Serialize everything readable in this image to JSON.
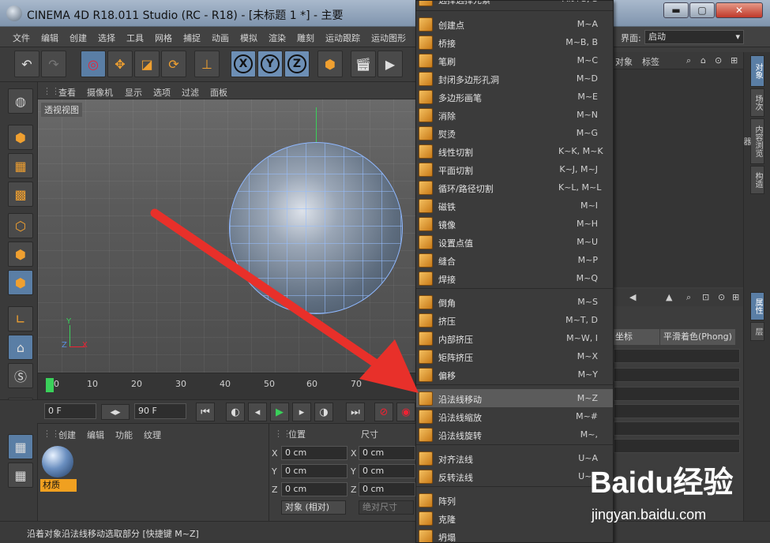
{
  "window": {
    "title": "CINEMA 4D R18.011 Studio (RC - R18) - [未标题 1 *] - 主要",
    "minimize": "▬",
    "maximize": "▢",
    "close": "✕"
  },
  "menubar": {
    "items": [
      "文件",
      "编辑",
      "创建",
      "选择",
      "工具",
      "网格",
      "捕捉",
      "动画",
      "模拟",
      "渲染",
      "雕刻",
      "运动跟踪",
      "运动图形"
    ],
    "interface_label": "界面:",
    "interface_value": "启动"
  },
  "toolbar": {
    "undo": "↶",
    "redo": "↷",
    "axis_x": "X",
    "axis_y": "Y",
    "axis_z": "Z"
  },
  "viewport": {
    "menu": [
      "查看",
      "摄像机",
      "显示",
      "选项",
      "过滤",
      "面板"
    ],
    "label": "透视视图",
    "axis_y": "Y",
    "axis_x": "X",
    "axis_z": "Z"
  },
  "timeline": {
    "ticks": [
      "0",
      "10",
      "20",
      "30",
      "40",
      "50",
      "60",
      "70"
    ]
  },
  "transport": {
    "start_frame": "0 F",
    "end_frame": "90 F"
  },
  "material_panel": {
    "tabs": [
      "创建",
      "编辑",
      "功能",
      "纹理"
    ],
    "material_label": "材质"
  },
  "coord_panel": {
    "position_label": "位置",
    "size_label": "尺寸",
    "x": "X",
    "y": "Y",
    "z": "Z",
    "px": "0 cm",
    "py": "0 cm",
    "pz": "0 cm",
    "sx": "0 cm",
    "sy": "0 cm",
    "sz": "0 cm",
    "object_mode": "对象 (相对)",
    "absolute_size": "绝对尺寸"
  },
  "right_panel": {
    "tabs": [
      "对象",
      "标签"
    ],
    "vtabs": [
      "对象",
      "场次",
      "内容浏览器",
      "构造"
    ],
    "attr_vtabs": [
      "属性",
      "层"
    ],
    "coord_tab": "坐标",
    "phong_tab": "平滑着色(Phong)"
  },
  "context_menu": {
    "top_partial": {
      "label": "选择选择元素",
      "key": "Alt+S, S"
    },
    "items": [
      {
        "label": "创建点",
        "key": "M~A"
      },
      {
        "label": "桥接",
        "key": "M~B, B"
      },
      {
        "label": "笔刷",
        "key": "M~C"
      },
      {
        "label": "封闭多边形孔洞",
        "key": "M~D"
      },
      {
        "label": "多边形画笔",
        "key": "M~E"
      },
      {
        "label": "消除",
        "key": "M~N"
      },
      {
        "label": "熨烫",
        "key": "M~G"
      },
      {
        "label": "线性切割",
        "key": "K~K, M~K"
      },
      {
        "label": "平面切割",
        "key": "K~J, M~J"
      },
      {
        "label": "循环/路径切割",
        "key": "K~L, M~L"
      },
      {
        "label": "磁铁",
        "key": "M~I"
      },
      {
        "label": "镜像",
        "key": "M~H"
      },
      {
        "label": "设置点值",
        "key": "M~U"
      },
      {
        "label": "缝合",
        "key": "M~P"
      },
      {
        "label": "焊接",
        "key": "M~Q"
      },
      {
        "label": "倒角",
        "key": "M~S"
      },
      {
        "label": "挤压",
        "key": "M~T, D"
      },
      {
        "label": "内部挤压",
        "key": "M~W, I"
      },
      {
        "label": "矩阵挤压",
        "key": "M~X"
      },
      {
        "label": "偏移",
        "key": "M~Y"
      },
      {
        "label": "沿法线移动",
        "key": "M~Z"
      },
      {
        "label": "沿法线缩放",
        "key": "M~#"
      },
      {
        "label": "沿法线旋转",
        "key": "M~,"
      },
      {
        "label": "对齐法线",
        "key": "U~A"
      },
      {
        "label": "反转法线",
        "key": "U~R"
      },
      {
        "label": "阵列",
        "key": ""
      },
      {
        "label": "克隆",
        "key": ""
      },
      {
        "label": "坍塌",
        "key": ""
      }
    ]
  },
  "statusbar": {
    "text": "沿着对象沿法线移动选取部分 [快捷键 M~Z]"
  },
  "watermark": {
    "brand": "Baidu经验",
    "url": "jingyan.baidu.com"
  },
  "colors": {
    "accent": "#5a7ea5",
    "highlight": "#5b5b5b",
    "arrow": "#e8302a",
    "material_label": "#f0a020"
  }
}
